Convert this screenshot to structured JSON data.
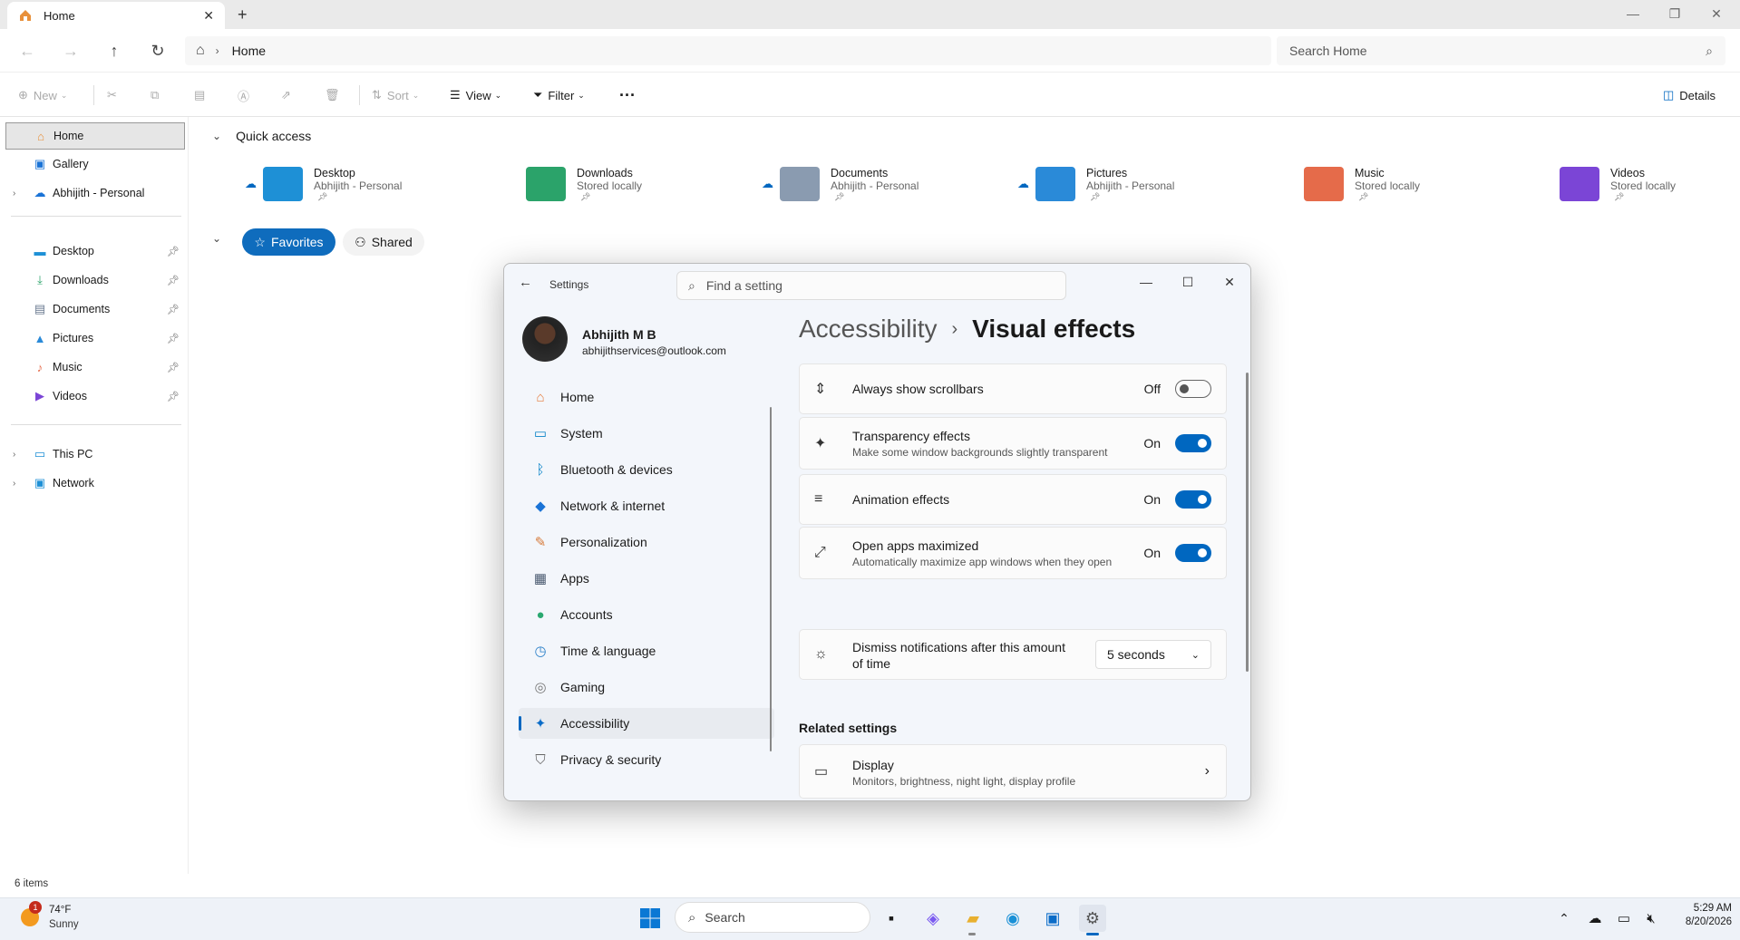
{
  "explorer": {
    "tab_title": "Home",
    "breadcrumb": "Home",
    "search_placeholder": "Search Home",
    "toolbar": {
      "new": "New",
      "sort": "Sort",
      "view": "View",
      "filter": "Filter",
      "details": "Details"
    },
    "sidebar": {
      "top": [
        {
          "label": "Home"
        },
        {
          "label": "Gallery"
        },
        {
          "label": "Abhijith - Personal"
        }
      ],
      "pinned": [
        {
          "label": "Desktop"
        },
        {
          "label": "Downloads"
        },
        {
          "label": "Documents"
        },
        {
          "label": "Pictures"
        },
        {
          "label": "Music"
        },
        {
          "label": "Videos"
        }
      ],
      "bottom": [
        {
          "label": "This PC"
        },
        {
          "label": "Network"
        }
      ]
    },
    "quick_access": {
      "title": "Quick access",
      "items": [
        {
          "name": "Desktop",
          "sub": "Abhijith - Personal",
          "color": "#1e90d6"
        },
        {
          "name": "Downloads",
          "sub": "Stored locally",
          "color": "#2ba36a"
        },
        {
          "name": "Documents",
          "sub": "Abhijith - Personal",
          "color": "#8a9bb0"
        },
        {
          "name": "Pictures",
          "sub": "Abhijith - Personal",
          "color": "#2a8ad8"
        },
        {
          "name": "Music",
          "sub": "Stored locally",
          "color": "#e56b4a"
        },
        {
          "name": "Videos",
          "sub": "Stored locally",
          "color": "#7b45d6"
        }
      ]
    },
    "filters": {
      "favorites": "Favorites",
      "shared": "Shared"
    },
    "status": "6 items"
  },
  "settings": {
    "title": "Settings",
    "find_placeholder": "Find a setting",
    "user": {
      "name": "Abhijith M B",
      "email": "abhijithservices@outlook.com"
    },
    "nav": [
      {
        "label": "Home",
        "icon": "home-icon",
        "glyph": "⌂",
        "color": "#e57a3a"
      },
      {
        "label": "System",
        "icon": "monitor-icon",
        "glyph": "▭",
        "color": "#0a84c8"
      },
      {
        "label": "Bluetooth & devices",
        "icon": "bluetooth-icon",
        "glyph": "ᛒ",
        "color": "#0a84c8"
      },
      {
        "label": "Network & internet",
        "icon": "wifi-icon",
        "glyph": "◆",
        "color": "#1a73d6"
      },
      {
        "label": "Personalization",
        "icon": "brush-icon",
        "glyph": "✎",
        "color": "#d67a3a"
      },
      {
        "label": "Apps",
        "icon": "apps-icon",
        "glyph": "▦",
        "color": "#4a5a70"
      },
      {
        "label": "Accounts",
        "icon": "person-icon",
        "glyph": "●",
        "color": "#2aa870"
      },
      {
        "label": "Time & language",
        "icon": "globe-clock-icon",
        "glyph": "◷",
        "color": "#2a7fc8"
      },
      {
        "label": "Gaming",
        "icon": "gamepad-icon",
        "glyph": "◎",
        "color": "#777"
      },
      {
        "label": "Accessibility",
        "icon": "accessibility-icon",
        "glyph": "✦",
        "color": "#0a6cc8"
      },
      {
        "label": "Privacy & security",
        "icon": "shield-icon",
        "glyph": "⛉",
        "color": "#666"
      }
    ],
    "breadcrumb": {
      "parent": "Accessibility",
      "current": "Visual effects"
    },
    "options": [
      {
        "label": "Always show scrollbars",
        "desc": "",
        "state": "Off",
        "on": false,
        "icon": "scrollbar-icon",
        "glyph": "⇕"
      },
      {
        "label": "Transparency effects",
        "desc": "Make some window backgrounds slightly transparent",
        "state": "On",
        "on": true,
        "icon": "transparency-icon",
        "glyph": "✦"
      },
      {
        "label": "Animation effects",
        "desc": "",
        "state": "On",
        "on": true,
        "icon": "animation-icon",
        "glyph": "≡"
      },
      {
        "label": "Open apps maximized",
        "desc": "Automatically maximize app windows when they open",
        "state": "On",
        "on": true,
        "icon": "maximize-arrow-icon",
        "glyph": "⤢"
      }
    ],
    "dismiss": {
      "label_line1": "Dismiss notifications after this amount",
      "label_line2": "of time",
      "value": "5 seconds"
    },
    "related": {
      "title": "Related settings",
      "display_label": "Display",
      "display_desc": "Monitors, brightness, night light, display profile"
    }
  },
  "taskbar": {
    "weather_temp": "74°F",
    "weather_desc": "Sunny",
    "weather_badge": "1",
    "search": "Search",
    "time": "5:29 AM",
    "date": "8/20/2026"
  }
}
